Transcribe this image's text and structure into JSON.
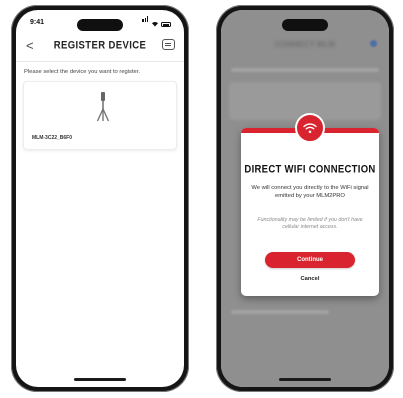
{
  "left_screen": {
    "status_time": "9:41",
    "title": "REGISTER DEVICE",
    "back_glyph": "<",
    "help_icon": "chat-help-icon",
    "instruction": "Please select the device you want to register.",
    "device_card": {
      "device_icon": "tripod-icon",
      "device_name": "MLM-3C22_B6F0"
    }
  },
  "right_screen": {
    "background_title": "CONNECT MLM",
    "modal": {
      "icon": "wifi-icon",
      "title": "DIRECT WIFI CONNECTION",
      "body": "We will connect you directly to the WiFi signal emitted by your MLM2PRO",
      "note": "Functionality may be limited if you don't have cellular internet access.",
      "continue_label": "Continue",
      "cancel_label": "Cancel"
    }
  },
  "colors": {
    "accent": "#d9232e",
    "phone_frame": "#151515",
    "dim_overlay": "#8f8f8f"
  }
}
